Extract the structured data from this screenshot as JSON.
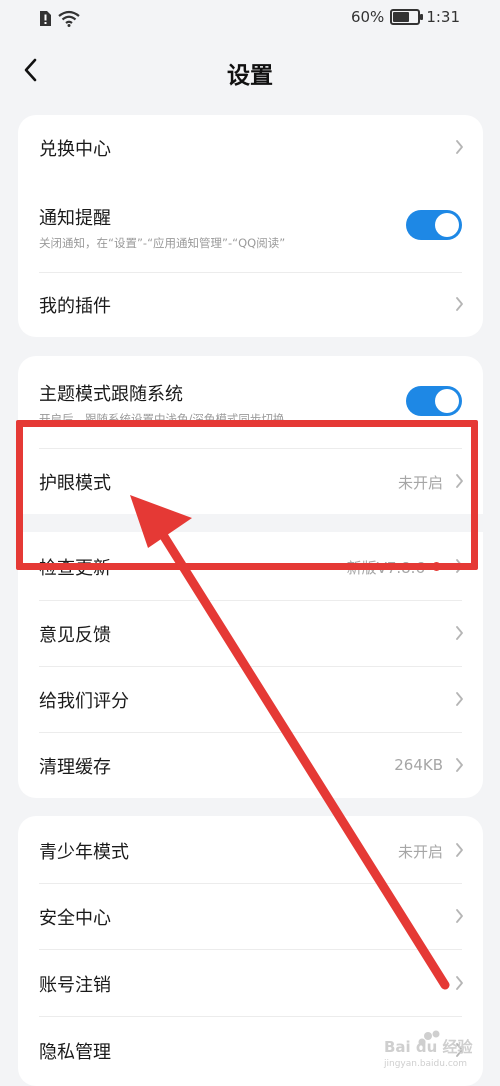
{
  "status_bar": {
    "battery_percent_text": "60%",
    "battery_level": 0.6,
    "time": "1:31",
    "icons": [
      "alert-sim-icon",
      "wifi-icon",
      "battery-icon"
    ]
  },
  "nav": {
    "title": "设置",
    "back_icon": "chevron-left-icon"
  },
  "group1": {
    "redeem": {
      "label": "兑换中心"
    },
    "notify": {
      "label": "通知提醒",
      "sub": "关闭通知，在“设置”-“应用通知管理”-“QQ阅读”",
      "toggle_on": true
    },
    "plugins": {
      "label": "我的插件"
    }
  },
  "group2": {
    "theme": {
      "label": "主题模式跟随系统",
      "sub": "开启后，跟随系统设置中浅色/深色模式同步切换",
      "toggle_on": true
    },
    "eye_care": {
      "label": "护眼模式",
      "value": "未开启"
    },
    "update": {
      "label": "检查更新",
      "value": "新版V7.8.6"
    },
    "feedback": {
      "label": "意见反馈"
    },
    "rate": {
      "label": "给我们评分"
    },
    "cache": {
      "label": "清理缓存",
      "value": "264KB"
    }
  },
  "group3": {
    "teen": {
      "label": "青少年模式",
      "value": "未开启"
    },
    "security": {
      "label": "安全中心"
    },
    "deregister": {
      "label": "账号注销"
    },
    "privacy": {
      "label": "隐私管理"
    }
  },
  "annotation": {
    "color": "#e53935"
  },
  "colors": {
    "toggle_on": "#1e88e5",
    "background": "#f3f4f6",
    "card": "#ffffff"
  },
  "watermark": {
    "brand": "Bai du 经验",
    "url": "jingyan.baidu.com"
  }
}
